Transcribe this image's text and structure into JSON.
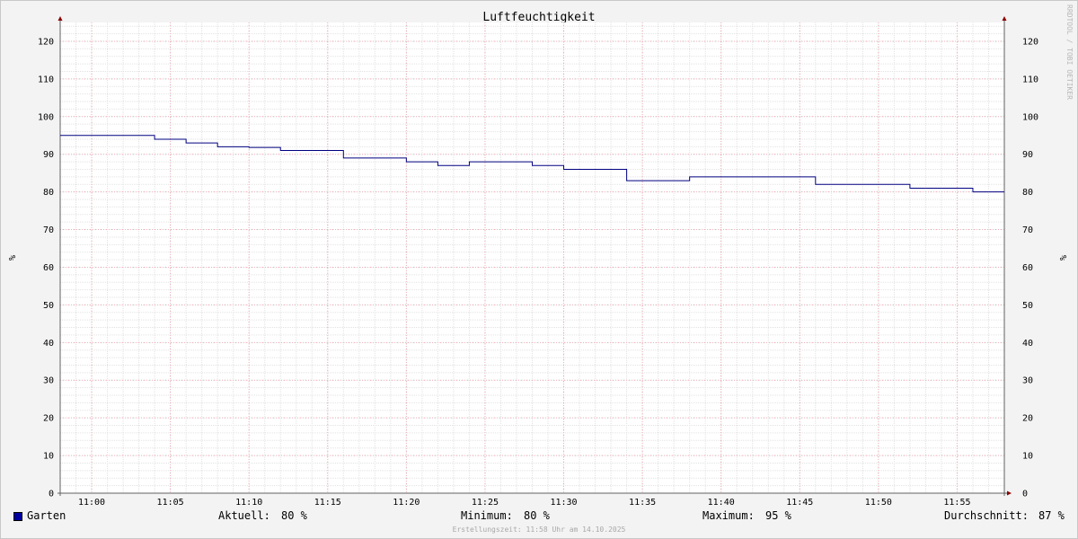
{
  "chart_data": {
    "type": "line",
    "title": "Luftfeuchtigkeit",
    "ylabel": "%",
    "ylim": [
      0,
      125
    ],
    "yticks": [
      0,
      10,
      20,
      30,
      40,
      50,
      60,
      70,
      80,
      90,
      100,
      110,
      120
    ],
    "xlim": [
      "10:58",
      "11:58"
    ],
    "xticks": [
      "11:00",
      "11:05",
      "11:10",
      "11:15",
      "11:20",
      "11:25",
      "11:30",
      "11:35",
      "11:40",
      "11:45",
      "11:50",
      "11:55"
    ],
    "grid": true,
    "watermark": "RRDTOOL / TOBI OETIKER",
    "series": [
      {
        "name": "Garten",
        "color": "#000080",
        "x": [
          "10:58",
          "11:04",
          "11:06",
          "11:08",
          "11:10",
          "11:12",
          "11:16",
          "11:20",
          "11:22",
          "11:24",
          "11:28",
          "11:30",
          "11:34",
          "11:38",
          "11:46",
          "11:52",
          "11:56",
          "11:58"
        ],
        "values": [
          95,
          94,
          93,
          92,
          91.8,
          91,
          89,
          88,
          87,
          88,
          87,
          86,
          83,
          84,
          82,
          81,
          80,
          80
        ]
      }
    ]
  },
  "legend": {
    "series_name": "Garten",
    "current_label": "Aktuell:",
    "current_value": "80 %",
    "min_label": "Minimum:",
    "min_value": "80 %",
    "max_label": "Maximum:",
    "max_value": "95 %",
    "avg_label": "Durchschnitt:",
    "avg_value": "87 %",
    "swatch_color": "#0000a0"
  },
  "footer": "Erstellungszeit: 11:58 Uhr am 14.10.2025"
}
